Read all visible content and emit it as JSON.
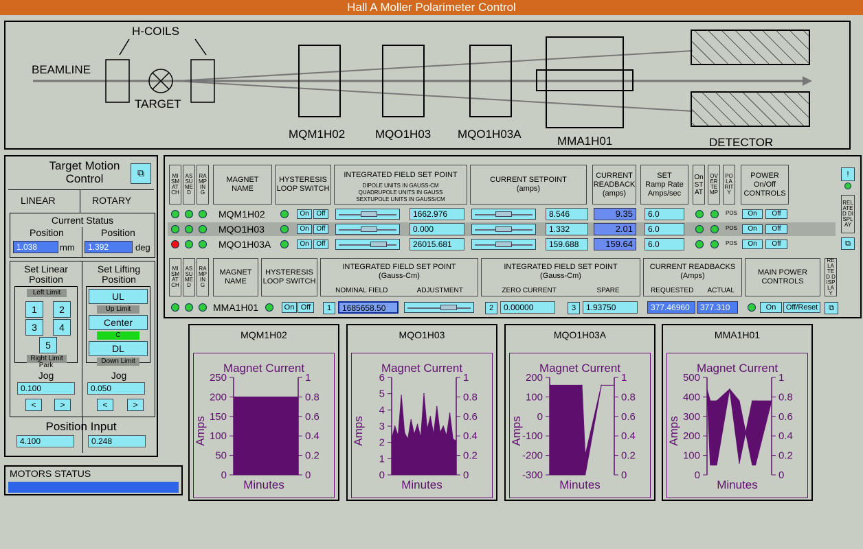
{
  "title": "Hall A Moller Polarimeter Control",
  "beamline": {
    "hcoils": "H-COILS",
    "beamline": "BEAMLINE",
    "target": "TARGET",
    "magnets": [
      "MQM1H02",
      "MQO1H03",
      "MQO1H03A",
      "MMA1H01"
    ],
    "detector": "DETECTOR"
  },
  "target_motion": {
    "title_line1": "Target Motion",
    "title_line2": "Control",
    "tab_linear": "LINEAR",
    "tab_rotary": "ROTARY",
    "current_status": "Current Status",
    "position_label": "Position",
    "linear_value": "1.038",
    "linear_unit": "mm",
    "rotary_value": "1.392",
    "rotary_unit": "deg",
    "set_linear": [
      "Set Linear",
      "Position"
    ],
    "set_lifting": [
      "Set Lifting",
      "Position"
    ],
    "left_limit": "Left Limit",
    "right_limit": "Right Limit",
    "park": "Park",
    "pos_buttons": [
      "1",
      "2",
      "3",
      "4",
      "5"
    ],
    "ul": "UL",
    "up_limit": "Up Limit",
    "center": "Center",
    "c": "C",
    "dl": "DL",
    "down_limit": "Down Limit",
    "jog": "Jog",
    "jog_linear": "0.100",
    "jog_lifting": "0.050",
    "left_arrow": "<",
    "right_arrow": ">",
    "position_input": "Position Input",
    "input_linear": "4.100",
    "input_lifting": "0.248"
  },
  "motors_status": {
    "label": "MOTORS STATUS",
    "color": "#2e64e8"
  },
  "quad_table": {
    "headers": {
      "mis_match": "MISMATCH",
      "assumed": "ASSUMED",
      "ramping": "RAMPING",
      "magnet_name": [
        "MAGNET",
        "NAME"
      ],
      "hysteresis": [
        "HYSTERESIS",
        "LOOP SWITCH"
      ],
      "int_field": "INTEGRATED FIELD SET POINT",
      "int_field_sub": [
        "DIPOLE UNITS IN GAUSS-CM",
        "QUADRUPOLE UNITS IN GAUSS",
        "SEXTUPOLE UNITS IN GAUSS/CM"
      ],
      "current_setpoint": [
        "CURRENT SETPOINT",
        "(amps)"
      ],
      "current_readback": [
        "CURRENT",
        "READBACK",
        "(amps)"
      ],
      "ramp_rate": [
        "SET",
        "Ramp Rate",
        "Amps/sec"
      ],
      "on_stat": "OnSTAT",
      "overtemp": "OVERTEMP",
      "polarity": "POLARITY",
      "power": [
        "POWER",
        "On/Off",
        "CONTROLS"
      ],
      "related": "RELATED DISPLAY"
    },
    "on_label": "On",
    "off_label": "Off",
    "pos_label": "POS",
    "rows": [
      {
        "name": "MQM1H02",
        "field": "1662.976",
        "setpoint": "8.546",
        "readback": "9.35",
        "ramp": "6.0",
        "mismatch": "#2fcb3a"
      },
      {
        "name": "MQO1H03",
        "field": "0.000",
        "setpoint": "1.332",
        "readback": "2.01",
        "ramp": "6.0",
        "mismatch": "#2fcb3a"
      },
      {
        "name": "MQO1H03A",
        "field": "26015.681",
        "setpoint": "159.688",
        "readback": "159.64",
        "ramp": "6.0",
        "mismatch": "#ee1010"
      }
    ]
  },
  "dipole_table": {
    "headers": {
      "magnet_name": [
        "MAGNET",
        "NAME"
      ],
      "hysteresis": [
        "HYSTERESIS",
        "LOOP SWITCH"
      ],
      "int_field": [
        "INTEGRATED FIELD SET POINT",
        "(Gauss-Cm)"
      ],
      "nominal": "NOMINAL FIELD",
      "adjustment": "ADJUSTMENT",
      "int_field2": [
        "INTEGRATED FIELD SET POINT",
        "(Gauss-Cm)"
      ],
      "zero_current": "ZERO CURRENT",
      "spare": "SPARE",
      "readbacks": [
        "CURRENT READBACKS",
        "(Amps)"
      ],
      "requested": "REQUESTED",
      "actual": "ACTUAL",
      "main_power": [
        "MAIN POWER",
        "CONTROLS"
      ],
      "related": "RELATED DISPLAY"
    },
    "name": "MMA1H01",
    "on_label": "On",
    "off_label": "Off",
    "off_reset_label": "Off/Reset",
    "btn1": "1",
    "btn2": "2",
    "btn3": "3",
    "nominal_value": "1685658.50",
    "zero_value": "0.00000",
    "spare_value": "1.93750",
    "requested_value": "377.46960",
    "actual_value": "377.310"
  },
  "charts_panel_titles": [
    "MQM1H02",
    "MQO1H03",
    "MQO1H03A",
    "MMA1H01"
  ],
  "chart_data": [
    {
      "type": "area",
      "panel": "MQM1H02",
      "title": "Magnet Current",
      "xlabel": "Minutes",
      "ylabel": "Amps",
      "ylim": [
        0,
        250
      ],
      "y_ticks": [
        0,
        50,
        100,
        150,
        200,
        250
      ],
      "y2lim": [
        0,
        1
      ],
      "y2_ticks": [
        0,
        0.2,
        0.4,
        0.6,
        0.8,
        1
      ],
      "x": [
        0,
        1
      ],
      "y": [
        200,
        200
      ]
    },
    {
      "type": "area",
      "panel": "MQO1H03",
      "title": "Magnet Current",
      "xlabel": "Minutes",
      "ylabel": "Amps",
      "ylim": [
        0,
        6
      ],
      "y_ticks": [
        0,
        1,
        2,
        3,
        4,
        5,
        6
      ],
      "y2lim": [
        0,
        1
      ],
      "y2_ticks": [
        0,
        0.2,
        0.4,
        0.6,
        0.8,
        1
      ],
      "x": [
        0,
        0.05,
        0.1,
        0.15,
        0.2,
        0.25,
        0.3,
        0.35,
        0.4,
        0.45,
        0.5,
        0.55,
        0.6,
        0.65,
        0.7,
        0.75,
        0.8,
        0.85,
        0.9,
        0.95,
        1
      ],
      "y": [
        2.2,
        3.0,
        2.4,
        4.9,
        2.6,
        2.2,
        3.4,
        2.5,
        3.1,
        2.3,
        5.0,
        2.8,
        3.6,
        2.5,
        4.2,
        2.6,
        3.0,
        2.4,
        3.8,
        2.2,
        2.1
      ]
    },
    {
      "type": "area",
      "panel": "MQO1H03A",
      "title": "Magnet Current",
      "xlabel": "Minutes",
      "ylabel": "Amps",
      "ylim": [
        -300,
        200
      ],
      "y_ticks": [
        -300,
        -200,
        -100,
        0,
        100,
        200
      ],
      "y2lim": [
        0,
        1
      ],
      "y2_ticks": [
        0,
        0.2,
        0.4,
        0.6,
        0.8,
        1
      ],
      "x": [
        0,
        0.5,
        0.55,
        0.8,
        1
      ],
      "y": [
        160,
        160,
        -200,
        160,
        160
      ],
      "ymin": [
        -300,
        -300,
        -300,
        160,
        160
      ]
    },
    {
      "type": "area",
      "panel": "MMA1H01",
      "title": "Magnet Current",
      "xlabel": "Minutes",
      "ylabel": "Amps",
      "ylim": [
        0,
        500
      ],
      "y_ticks": [
        0,
        100,
        200,
        300,
        400,
        500
      ],
      "y2lim": [
        0,
        1
      ],
      "y2_ticks": [
        0,
        0.2,
        0.4,
        0.6,
        0.8,
        1
      ],
      "x": [
        0,
        0.05,
        0.15,
        0.35,
        0.5,
        0.7,
        0.75,
        1
      ],
      "y": [
        440,
        380,
        380,
        440,
        60,
        380,
        380,
        380
      ],
      "ymin": [
        440,
        50,
        50,
        440,
        380,
        50,
        50,
        380
      ]
    }
  ]
}
